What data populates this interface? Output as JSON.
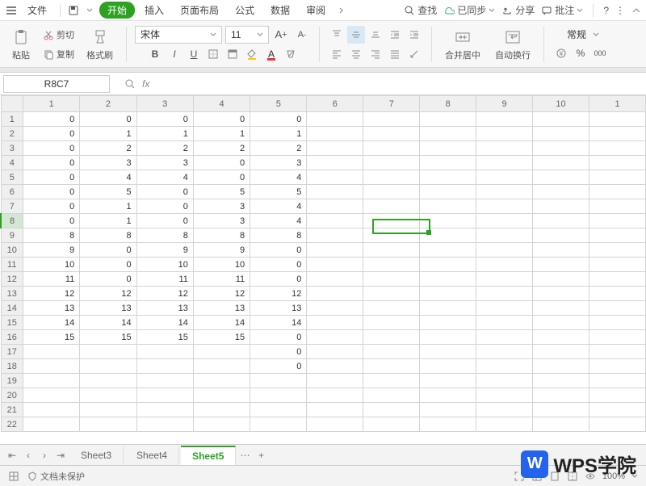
{
  "menu": {
    "file": "文件",
    "tabs": [
      "开始",
      "插入",
      "页面布局",
      "公式",
      "数据",
      "审阅"
    ],
    "find": "查找",
    "synced": "已同步",
    "share": "分享",
    "comment": "批注"
  },
  "toolbar": {
    "paste": "粘贴",
    "cut": "剪切",
    "copy": "复制",
    "formatpainter": "格式刷",
    "fontname": "宋体",
    "fontsize": "11",
    "merge": "合并居中",
    "wrap": "自动换行",
    "general": "常规"
  },
  "namebox": "R8C7",
  "sheets": {
    "s3": "Sheet3",
    "s4": "Sheet4",
    "s5": "Sheet5"
  },
  "status": {
    "protect": "文档未保护",
    "zoom": "100%"
  },
  "watermark": "WPS学院",
  "cols": [
    "1",
    "2",
    "3",
    "4",
    "5",
    "6",
    "7",
    "8",
    "9",
    "10",
    "1"
  ],
  "rows": [
    "1",
    "2",
    "3",
    "4",
    "5",
    "6",
    "7",
    "8",
    "9",
    "10",
    "11",
    "12",
    "13",
    "14",
    "15",
    "16",
    "17",
    "18",
    "19",
    "20",
    "21",
    "22"
  ],
  "cells": {
    "r1": {
      "c1": "0",
      "c2": "0",
      "c3": "0",
      "c4": "0",
      "c5": "0"
    },
    "r2": {
      "c1": "0",
      "c2": "1",
      "c3": "1",
      "c4": "1",
      "c5": "1"
    },
    "r3": {
      "c1": "0",
      "c2": "2",
      "c3": "2",
      "c4": "2",
      "c5": "2"
    },
    "r4": {
      "c1": "0",
      "c2": "3",
      "c3": "3",
      "c4": "0",
      "c5": "3"
    },
    "r5": {
      "c1": "0",
      "c2": "4",
      "c3": "4",
      "c4": "0",
      "c5": "4"
    },
    "r6": {
      "c1": "0",
      "c2": "5",
      "c3": "0",
      "c4": "5",
      "c5": "5"
    },
    "r7": {
      "c1": "0",
      "c2": "1",
      "c3": "0",
      "c4": "3",
      "c5": "4"
    },
    "r8": {
      "c1": "0",
      "c2": "1",
      "c3": "0",
      "c4": "3",
      "c5": "4"
    },
    "r9": {
      "c1": "8",
      "c2": "8",
      "c3": "8",
      "c4": "8",
      "c5": "8"
    },
    "r10": {
      "c1": "9",
      "c2": "0",
      "c3": "9",
      "c4": "9",
      "c5": "0"
    },
    "r11": {
      "c1": "10",
      "c2": "0",
      "c3": "10",
      "c4": "10",
      "c5": "0"
    },
    "r12": {
      "c1": "11",
      "c2": "0",
      "c3": "11",
      "c4": "11",
      "c5": "0"
    },
    "r13": {
      "c1": "12",
      "c2": "12",
      "c3": "12",
      "c4": "12",
      "c5": "12"
    },
    "r14": {
      "c1": "13",
      "c2": "13",
      "c3": "13",
      "c4": "13",
      "c5": "13"
    },
    "r15": {
      "c1": "14",
      "c2": "14",
      "c3": "14",
      "c4": "14",
      "c5": "14"
    },
    "r16": {
      "c1": "15",
      "c2": "15",
      "c3": "15",
      "c4": "15",
      "c5": "0"
    },
    "r17": {
      "c5": "0"
    },
    "r18": {
      "c5": "0"
    }
  }
}
